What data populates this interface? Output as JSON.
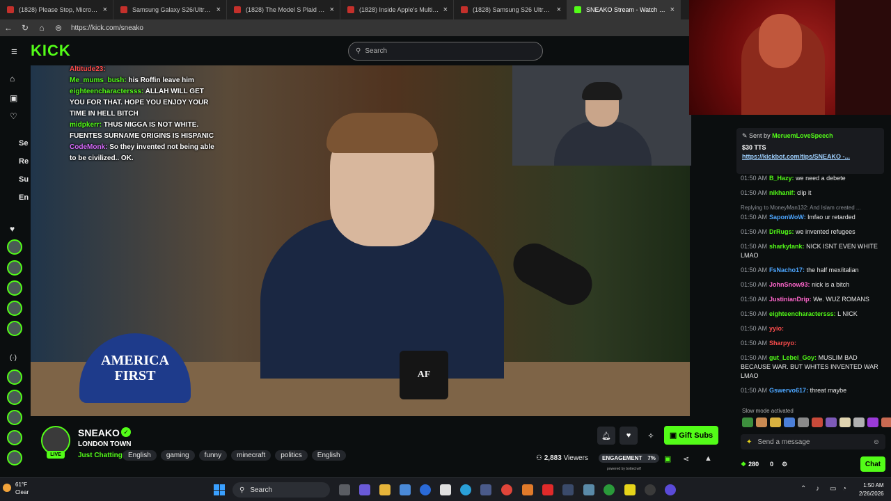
{
  "browser": {
    "tabs": [
      {
        "title": "(1828) Please Stop, Microsoft... - Y",
        "active": false
      },
      {
        "title": "Samsung Galaxy S26/Ultra Impre",
        "active": false
      },
      {
        "title": "(1828) The Model S Plaid Walked",
        "active": false
      },
      {
        "title": "(1828) Inside Apple's Multibillion",
        "active": false
      },
      {
        "title": "(1828) Samsung S26 Ultra Hands",
        "active": false
      },
      {
        "title": "SNEAKO Stream - Watch Live",
        "active": true
      }
    ],
    "close_glyph": "×",
    "url": "https://kick.com/sneako"
  },
  "site": {
    "logo": "KICK",
    "search_placeholder": "Search"
  },
  "rail": {
    "items": [
      "Se",
      "Re",
      "Su",
      "En"
    ]
  },
  "overlay_chat": [
    {
      "user": "Altitude23:",
      "text": "",
      "color": "#ff4d4d"
    },
    {
      "user": "Me_mums_bush:",
      "text": "his Roffin leave him",
      "color": "#53fc18"
    },
    {
      "user": "eighteencharactersss:",
      "text": "ALLAH WILL GET YOU FOR THAT. HOPE YOU ENJOY YOUR TIME IN HELL BITCH",
      "color": "#53fc18"
    },
    {
      "user": "midpkerr:",
      "text": "THUS NIGGA IS NOT WHITE. FUENTES SURNAME ORIGINS IS HISPANIC",
      "color": "#53fc18"
    },
    {
      "user": "CodeMonk:",
      "text": "So they invented not being able to be civilized.. OK.",
      "color": "#d96cff"
    }
  ],
  "video": {
    "hat_text": [
      "AMERICA",
      "FIRST"
    ],
    "mug_text": "AF"
  },
  "pinned": {
    "sent_by_label": "Sent by",
    "sender": "MeruemLoveSpeech",
    "amount": "$30 TTS",
    "link": "https://kickbot.com/tips/SNEAKO -..."
  },
  "chat_messages": [
    {
      "time": "01:50 AM",
      "user": "B_Hazy:",
      "text": "we need a debete",
      "color": "#53fc18"
    },
    {
      "time": "01:50 AM",
      "user": "nikhanif:",
      "text": "clip it",
      "color": "#53fc18"
    },
    {
      "reply": "Replying to MoneyMan132: And Islam created ..."
    },
    {
      "time": "01:50 AM",
      "user": "SaponWoW:",
      "text": "lmfao ur retarded",
      "color": "#4da6ff"
    },
    {
      "time": "01:50 AM",
      "user": "DrRugs:",
      "text": "we invented refugees",
      "color": "#53fc18"
    },
    {
      "time": "01:50 AM",
      "user": "sharkytank:",
      "text": "NICK ISNT EVEN WHITE LMAO",
      "color": "#53fc18"
    },
    {
      "time": "01:50 AM",
      "user": "FsNacho17:",
      "text": "the half mex/italian",
      "color": "#4da6ff"
    },
    {
      "time": "01:50 AM",
      "user": "JohnSnow93:",
      "text": "nick is a bitch",
      "color": "#ff66cc"
    },
    {
      "time": "01:50 AM",
      "user": "JustinianDrip:",
      "text": "We. WUZ ROMANS",
      "color": "#ff66cc"
    },
    {
      "time": "01:50 AM",
      "user": "eighteencharactersss:",
      "text": "L NICK",
      "color": "#53fc18"
    },
    {
      "time": "01:50 AM",
      "user": "yyio:",
      "text": "",
      "color": "#ff4d4d"
    },
    {
      "time": "01:50 AM",
      "user": "Sharpyo:",
      "text": "",
      "color": "#ff4d4d"
    },
    {
      "time": "01:50 AM",
      "user": "gut_Lebel_Goy:",
      "text": "MUSLIM BAD BECAUSE WAR. BUT WHITES INVENTED WAR LMAO",
      "color": "#53fc18"
    },
    {
      "time": "01:50 AM",
      "user": "Gswervo617:",
      "text": "threat maybe",
      "color": "#4da6ff"
    }
  ],
  "chat_footer": {
    "slow_mode": "Slow mode activated",
    "send_placeholder": "Send a message",
    "points": "280",
    "zero": "0",
    "chat_button": "Chat"
  },
  "stream": {
    "name": "SNEAKO",
    "title": "LONDON TOWN",
    "live_label": "LIVE",
    "category": "Just Chatting",
    "tags": [
      "English",
      "gaming",
      "funny",
      "minecraft",
      "politics",
      "English"
    ],
    "gift_button": "Gift Subs",
    "viewer_count": "2,883",
    "viewers_label": "Viewers",
    "engagement_label": "ENGAGEMENT",
    "engagement_pct": "7%",
    "powered_by": "powered by botted.wtf"
  },
  "taskbar": {
    "temp": "61°F",
    "condition": "Clear",
    "search": "Search",
    "time": "1:50 AM",
    "date": "2/26/2026"
  },
  "colors": {
    "accent": "#53fc18",
    "background": "#0b0e0f"
  }
}
